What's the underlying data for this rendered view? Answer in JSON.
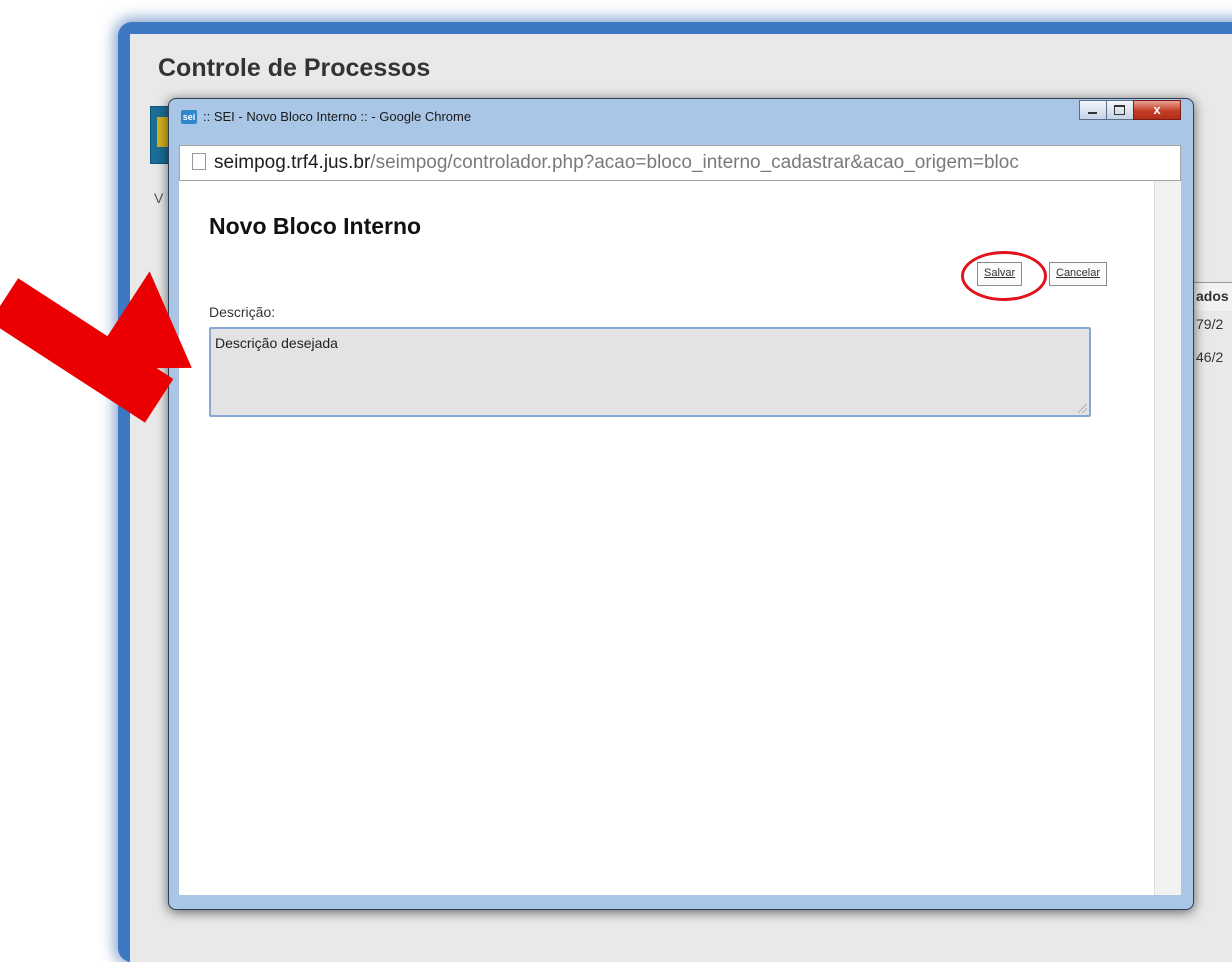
{
  "background": {
    "title": "Controle de Processos",
    "left_label": "V",
    "table_header": "ados",
    "table_cells": [
      "79/2",
      "46/2"
    ]
  },
  "popup": {
    "window_title": ":: SEI - Novo Bloco Interno :: - Google Chrome",
    "app_icon_text": "sei",
    "controls": {
      "close": "x"
    },
    "url_host": "seimpog.trf4.jus.br",
    "url_path": "/seimpog/controlador.php?acao=bloco_interno_cadastrar&acao_origem=bloc"
  },
  "form": {
    "heading": "Novo Bloco Interno",
    "save_label": "Salvar",
    "cancel_label": "Cancelar",
    "description_label": "Descrição:",
    "description_value": "Descrição desejada"
  },
  "colors": {
    "annotation": "#ea0000",
    "window_frame": "#3d78c2",
    "toolbar_button": "#1a6e98"
  }
}
